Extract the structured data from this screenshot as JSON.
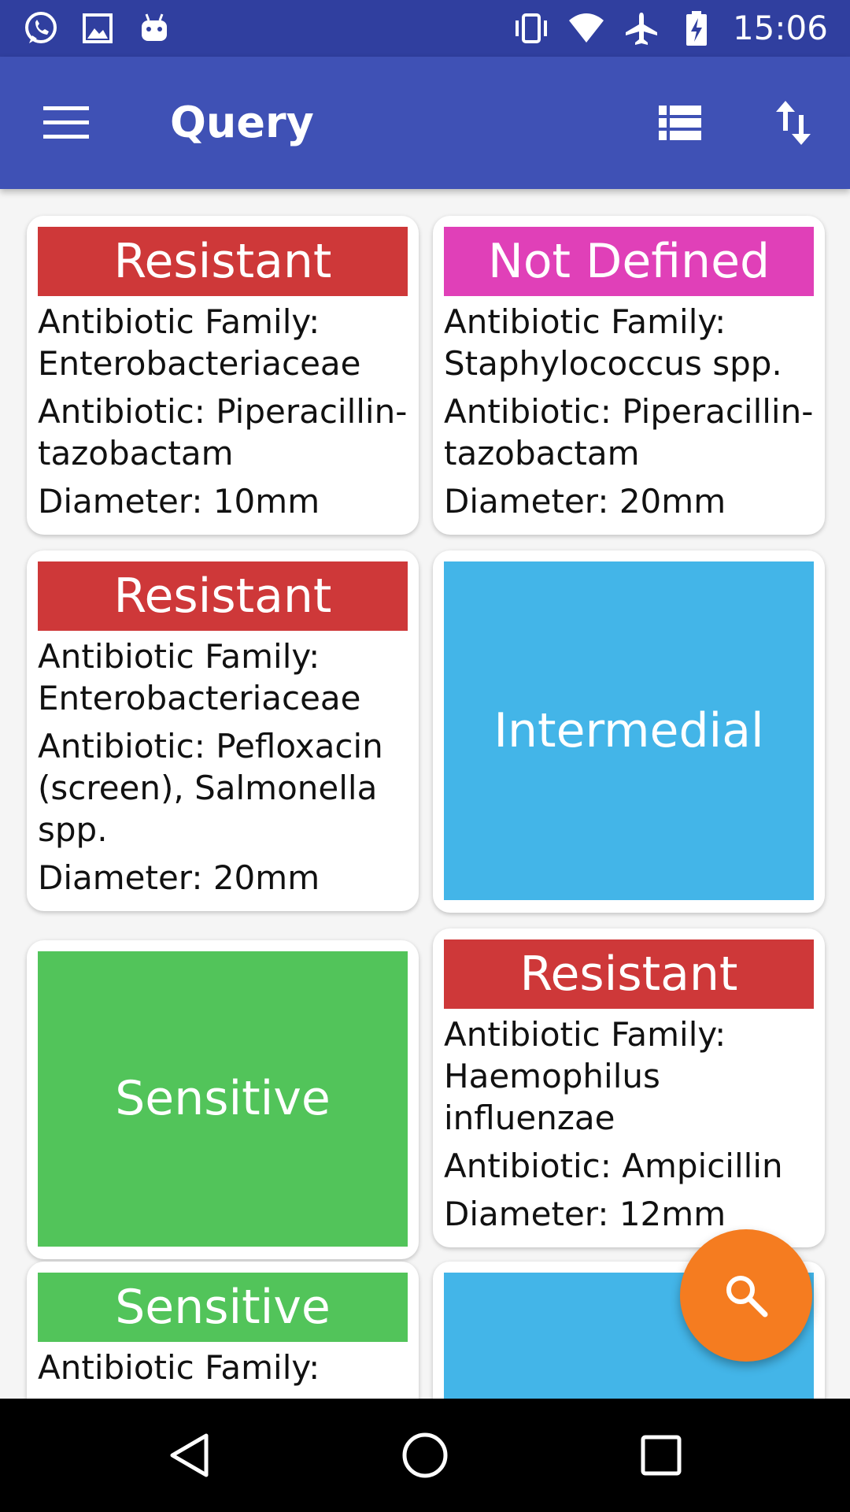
{
  "status_bar": {
    "time": "15:06",
    "left_icons": [
      "whatsapp-icon",
      "image-icon",
      "android-icon"
    ],
    "right_icons": [
      "vibrate-icon",
      "wifi-icon",
      "airplane-icon",
      "battery-charging-icon"
    ]
  },
  "app_bar": {
    "title": "Query",
    "color": "#3F51B5",
    "actions": [
      "list-view-icon",
      "sort-icon"
    ]
  },
  "colors": {
    "resistant": "#CE3839",
    "not_defined": "#E040B8",
    "intermedial": "#43B5E8",
    "sensitive": "#52C45A",
    "fab": "#F57C20"
  },
  "cards": [
    {
      "status": "Resistant",
      "family": "Antibiotic Family: Enterobacteriaceae",
      "antibiotic": "Antibiotic: Piperacillin-tazobactam",
      "diameter": "Diameter: 10mm"
    },
    {
      "status": "Not Defined",
      "family": "Antibiotic Family: Staphylococcus spp.",
      "antibiotic": "Antibiotic: Piperacillin-tazobactam",
      "diameter": "Diameter: 20mm"
    },
    {
      "status": "Resistant",
      "family": "Antibiotic Family: Enterobacteriaceae",
      "antibiotic": "Antibiotic: Pefloxacin (screen), Salmonella spp.",
      "diameter": "Diameter: 20mm"
    },
    {
      "status": "Intermedial"
    },
    {
      "status": "Sensitive"
    },
    {
      "status": "Resistant",
      "family": "Antibiotic Family: Haemophilus influenzae",
      "antibiotic": "Antibiotic: Ampicillin",
      "diameter": "Diameter: 12mm"
    },
    {
      "status": "Sensitive",
      "family": "Antibiotic Family:"
    },
    {
      "status": ""
    }
  ],
  "fab": {
    "icon": "search-icon"
  },
  "nav_bar": {
    "buttons": [
      "back-icon",
      "home-icon",
      "recents-icon"
    ]
  }
}
